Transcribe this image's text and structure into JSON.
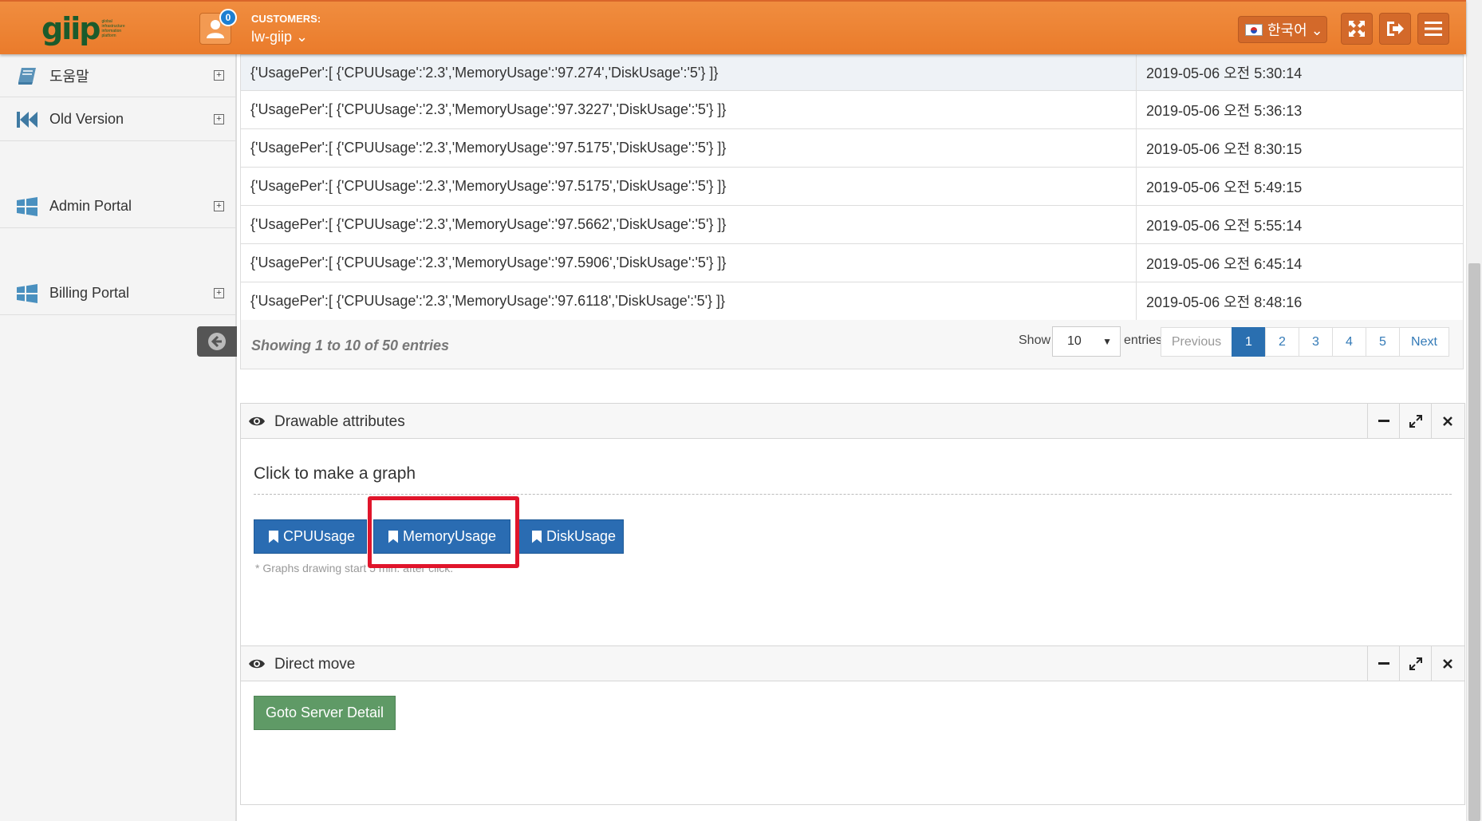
{
  "header": {
    "logo_text": "giip",
    "logo_subtext": "global infrastructure information platform",
    "notification_count": "0",
    "customers_label": "CUSTOMERS:",
    "customer_name": "lw-giip ⌄",
    "language": "한국어 ⌄"
  },
  "sidebar": {
    "items": [
      {
        "label": "도움말",
        "icon": "book-icon"
      },
      {
        "label": "Old Version",
        "icon": "fast-backward-icon"
      },
      {
        "label": "Admin Portal",
        "icon": "windows-icon"
      },
      {
        "label": "Billing Portal",
        "icon": "windows-icon"
      }
    ],
    "expand_symbol": "+"
  },
  "table": {
    "rows": [
      {
        "usage": "{'UsagePer':[ {'CPUUsage':'2.3','MemoryUsage':'97.274','DiskUsage':'5'} ]}",
        "time": "2019-05-06 오전 5:30:14"
      },
      {
        "usage": "{'UsagePer':[ {'CPUUsage':'2.3','MemoryUsage':'97.3227','DiskUsage':'5'} ]}",
        "time": "2019-05-06 오전 5:36:13"
      },
      {
        "usage": "{'UsagePer':[ {'CPUUsage':'2.3','MemoryUsage':'97.5175','DiskUsage':'5'} ]}",
        "time": "2019-05-06 오전 8:30:15"
      },
      {
        "usage": "{'UsagePer':[ {'CPUUsage':'2.3','MemoryUsage':'97.5175','DiskUsage':'5'} ]}",
        "time": "2019-05-06 오전 5:49:15"
      },
      {
        "usage": "{'UsagePer':[ {'CPUUsage':'2.3','MemoryUsage':'97.5662','DiskUsage':'5'} ]}",
        "time": "2019-05-06 오전 5:55:14"
      },
      {
        "usage": "{'UsagePer':[ {'CPUUsage':'2.3','MemoryUsage':'97.5906','DiskUsage':'5'} ]}",
        "time": "2019-05-06 오전 6:45:14"
      },
      {
        "usage": "{'UsagePer':[ {'CPUUsage':'2.3','MemoryUsage':'97.6118','DiskUsage':'5'} ]}",
        "time": "2019-05-06 오전 8:48:16"
      }
    ],
    "showing_text": "Showing 1 to 10 of 50 entries",
    "show_label": "Show",
    "page_length": "10",
    "entries_label": "entries",
    "pagination": {
      "previous": "Previous",
      "pages": [
        "1",
        "2",
        "3",
        "4",
        "5"
      ],
      "active_page": "1",
      "next": "Next"
    }
  },
  "drawable_panel": {
    "title": "Drawable attributes",
    "graph_heading": "Click to make a graph",
    "buttons": [
      "CPUUsage",
      "MemoryUsage",
      "DiskUsage"
    ],
    "highlighted_button": "MemoryUsage",
    "note": "* Graphs drawing start 5 min. after click."
  },
  "direct_panel": {
    "title": "Direct move",
    "goto_button": "Goto Server Detail"
  },
  "colors": {
    "header_orange": "#ec8233",
    "primary_blue": "#2a6cb2",
    "success_green": "#5f9a66",
    "highlight_red": "#e0152b"
  }
}
